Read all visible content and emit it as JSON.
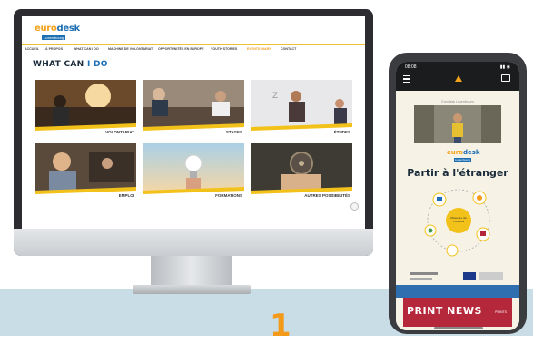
{
  "number_mark": "1",
  "desktop_site": {
    "logo": {
      "part1": "euro",
      "part2": "desk",
      "sub": "Luxembourg"
    },
    "nav": [
      {
        "label": "ACCUEIL",
        "active": false
      },
      {
        "label": "À PROPOS",
        "active": false
      },
      {
        "label": "WHAT CAN I DO",
        "active": false
      },
      {
        "label": "MACHINE DE VOLONTARIAT",
        "active": false
      },
      {
        "label": "OPPORTUNITÉS EN EUROPE",
        "active": false
      },
      {
        "label": "YOUTH STORIES",
        "active": false
      },
      {
        "label": "EVENTS DIARY",
        "active": true
      },
      {
        "label": "CONTACT",
        "active": false
      }
    ],
    "heading": {
      "main": "WHAT CAN",
      "accent": "I DO"
    },
    "cards": [
      {
        "label": "VOLONTARIAT"
      },
      {
        "label": "STAGES"
      },
      {
        "label": "ÉTUDES"
      },
      {
        "label": "EMPLOI"
      },
      {
        "label": "FORMATIONS"
      },
      {
        "label": "AUTRES POSSIBILITÉS"
      }
    ]
  },
  "phone_app": {
    "status": {
      "time": "08:08",
      "icons": "▮▮ ◉"
    },
    "caption": "Eurodesk Luxembourg",
    "logo": {
      "part1": "euro",
      "part2": "desk",
      "sub": "Luxembourg"
    },
    "title": "Partir à l'étranger",
    "diagram_center": "Mesures de mobilité Nations de ma Europe",
    "banner": {
      "text": "PRINT NEWS",
      "tag": "PRINTS"
    }
  },
  "colors": {
    "accent": "#f39a1b",
    "brand_blue": "#1d6fb4",
    "band": "#c9dde7",
    "stripe": "#f3c21a"
  }
}
